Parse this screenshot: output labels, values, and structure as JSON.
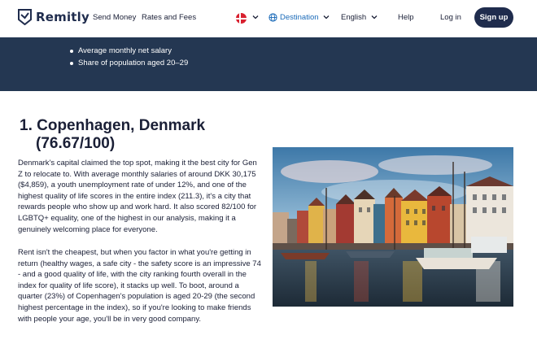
{
  "header": {
    "brand": "Remitly",
    "nav": {
      "send_money": "Send Money",
      "rates_fees": "Rates and Fees",
      "destination": "Destination",
      "language": "English",
      "help": "Help",
      "login": "Log in",
      "signup": "Sign up"
    },
    "icons": {
      "logo": "remitly-logo-icon",
      "flag": "denmark-flag-icon",
      "globe": "globe-icon",
      "chevron": "chevron-down-icon"
    },
    "colors": {
      "brand": "#1f2c4d",
      "link": "#1a6ab8"
    }
  },
  "band": {
    "bullets": [
      "Average monthly net salary",
      "Share of population aged 20–29"
    ],
    "color": "#243752"
  },
  "article": {
    "title_line1": "1. Copenhagen, Denmark",
    "title_line2": "(76.67/100)",
    "paragraph1": "Denmark's capital claimed the top spot, making it the best city for Gen Z to relocate to. With average monthly salaries of around DKK 30,175 ($4,859), a youth unemployment rate of under 12%, and one of the highest quality of life scores in the entire index (211.3), it's a city that rewards people who show up and work hard. It also scored 82/100 for LGBTQ+ equality, one of the highest in our analysis, making it a genuinely welcoming place for everyone.",
    "paragraph2": "Rent isn't the cheapest, but when you factor in what you're getting in return (healthy wages, a safe city - the safety score is an impressive 74 - and a good quality of life, with the city ranking fourth overall in the index for quality of life score), it stacks up well. To boot, around a quarter (23%) of Copenhagen's population is aged 20-29 (the second highest percentage in the index), so if you're looking to make friends with people your age, you'll be in very good company."
  }
}
